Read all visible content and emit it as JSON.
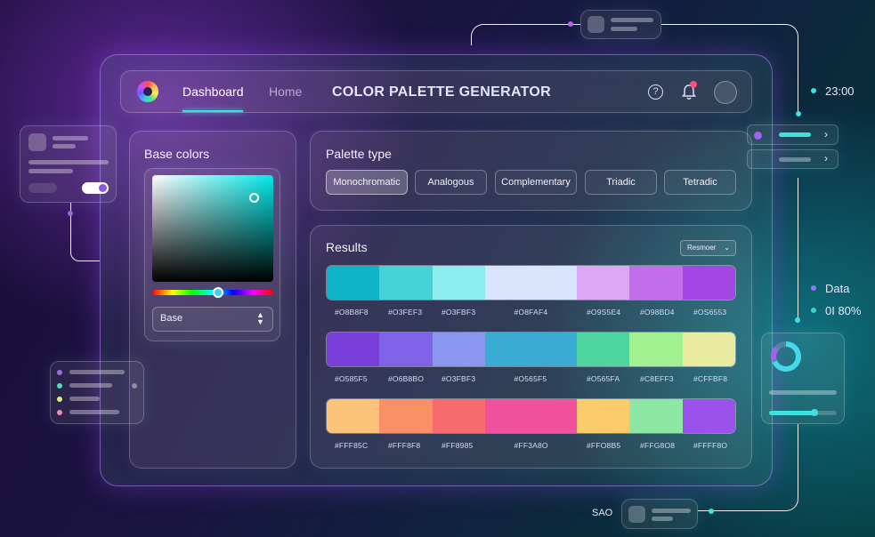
{
  "app": {
    "title": "COLOR PALETTE GENERATOR",
    "nav": {
      "dashboard": "Dashboard",
      "home": "Home"
    },
    "icons": {
      "logo": "color-wheel-icon",
      "help": "help-icon",
      "notifications": "bell-icon",
      "profile": "avatar"
    },
    "help_glyph": "?"
  },
  "base_colors": {
    "title": "Base colors",
    "select_value": "Base",
    "picker_hue": "cyan"
  },
  "palette_type": {
    "title": "Palette type",
    "options": [
      "Monochromatic",
      "Analogous",
      "Complementary",
      "Triadic",
      "Tetradic"
    ],
    "selected": "Monochromatic"
  },
  "results": {
    "title": "Results",
    "reorder_label": "Resmoer",
    "rows": [
      {
        "colors": [
          "#0FB5C6",
          "#45D3DA",
          "#8DEDEE",
          "#D8E4FB",
          "#DDA7F5",
          "#C06EEA",
          "#A446E4"
        ],
        "labels": [
          "#O8B8F8",
          "#O3FEF3",
          "#O3FBF3",
          "#O8FAF4",
          "#O9S5E4",
          "#O98BD4",
          "#OS6553"
        ]
      },
      {
        "colors": [
          "#7B3FD9",
          "#7F63E6",
          "#8B97EE",
          "#3AACD3",
          "#4FD6A0",
          "#A2F08F",
          "#E9EBA1"
        ],
        "labels": [
          "#O585F5",
          "#O6B8BO",
          "#O3FBF3",
          "#O565F5",
          "#O565FA",
          "#C8EFF3",
          "#CFFBF8"
        ]
      },
      {
        "colors": [
          "#FCC37A",
          "#FB8F66",
          "#F76B6E",
          "#F0509C",
          "#FCCB6A",
          "#8DE8A6",
          "#9B52EA"
        ],
        "labels": [
          "#FFF85C",
          "#FFF8F8",
          "#FF8985",
          "#FF3A8O",
          "#FFO8B5",
          "#FFG8O8",
          "#FFFF8O"
        ]
      }
    ]
  },
  "side": {
    "time": "23:00",
    "data_label": "Data",
    "percent": "0I 80%",
    "bottom_label": "SAO"
  },
  "colors": {
    "accent_cyan": "#3FE0E0",
    "accent_purple": "#A050FF",
    "notification": "#FF4D7D"
  }
}
